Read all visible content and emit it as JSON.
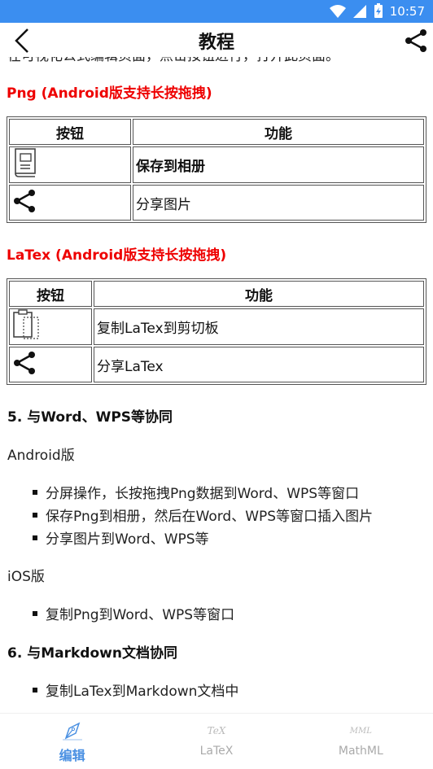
{
  "status": {
    "time": "10:57"
  },
  "appbar": {
    "title": "教程"
  },
  "content": {
    "partial_line": "在可视化公式编辑页面，点击按钮进行，打开此页面。",
    "png_head": "Png (Android版支持长按拖拽)",
    "table_headers": {
      "button": "按钮",
      "function": "功能"
    },
    "png_rows": [
      {
        "icon": "album-save-icon",
        "label": "保存到相册"
      },
      {
        "icon": "share-icon",
        "label": "分享图片"
      }
    ],
    "latex_head": "LaTex (Android版支持长按拖拽)",
    "latex_rows": [
      {
        "icon": "clipboard-icon",
        "label": "复制LaTex到剪切板"
      },
      {
        "icon": "share-icon",
        "label": "分享LaTex"
      }
    ],
    "sec5": "5. 与Word、WPS等协同",
    "android": "Android版",
    "android_items": [
      "分屏操作，长按拖拽Png数据到Word、WPS等窗口",
      "保存Png到相册，然后在Word、WPS等窗口插入图片",
      "分享图片到Word、WPS等"
    ],
    "ios": "iOS版",
    "ios_items": [
      "复制Png到Word、WPS等窗口"
    ],
    "sec6": "6. 与Markdown文档协同",
    "md_items": [
      "复制LaTex到Markdown文档中"
    ]
  },
  "nav": {
    "tabs": [
      {
        "label": "编辑",
        "icon": "pen-icon",
        "mark": ""
      },
      {
        "label": "LaTeX",
        "icon": "tex-icon",
        "mark": "TeX"
      },
      {
        "label": "MathML",
        "icon": "mml-icon",
        "mark": "MML"
      }
    ]
  },
  "colors": {
    "status_bar": "#3b8ef0",
    "heading_red": "#ee0000",
    "active_tab": "#4a90e2"
  }
}
